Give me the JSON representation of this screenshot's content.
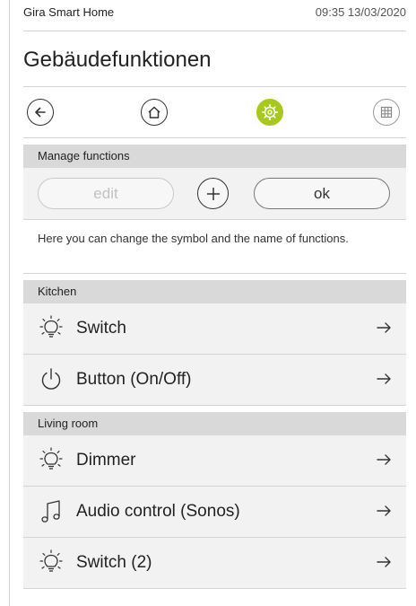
{
  "statusbar": {
    "app_name": "Gira Smart Home",
    "clock": "09:35 13/03/2020"
  },
  "page": {
    "title": "Gebäudefunktionen"
  },
  "toolbar": {
    "items": [
      {
        "icon": "back-arrow-icon"
      },
      {
        "icon": "home-icon"
      },
      {
        "icon": "settings-gear-icon",
        "active": true,
        "accent": "#a8c81f"
      },
      {
        "icon": "grid-icon"
      }
    ]
  },
  "manage": {
    "header": "Manage functions",
    "edit_label": "edit",
    "ok_label": "ok",
    "info_text": "Here you can change the symbol and the name of functions."
  },
  "sections": [
    {
      "name": "Kitchen",
      "items": [
        {
          "label": "Switch",
          "icon": "lightbulb-icon"
        },
        {
          "label": "Button (On/Off)",
          "icon": "power-icon"
        }
      ]
    },
    {
      "name": "Living room",
      "items": [
        {
          "label": "Dimmer",
          "icon": "lightbulb-icon"
        },
        {
          "label": "Audio control (Sonos)",
          "icon": "music-note-icon"
        },
        {
          "label": "Switch (2)",
          "icon": "lightbulb-icon"
        }
      ]
    }
  ]
}
